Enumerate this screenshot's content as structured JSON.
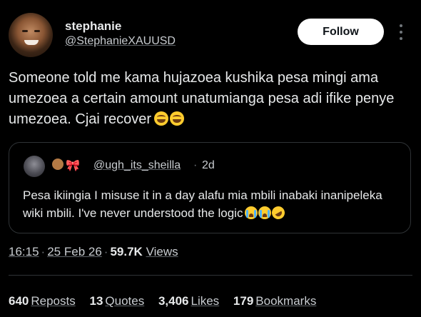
{
  "author": {
    "display_name": "stephanie",
    "handle": "@StephanieXAUUSD"
  },
  "follow_label": "Follow",
  "tweet": {
    "text": "Someone told me kama hujazoea kushika pesa mingi ama umezoea a certain amount unatumianga pesa adi ifike penye umezoea. Cjai recover",
    "emojis": [
      "grinning-squinting-face",
      "grinning-squinting-face"
    ]
  },
  "quote": {
    "handle": "@ugh_its_sheilla",
    "separator": "·",
    "time": "2d",
    "decor_emojis": [
      "teddy-bear",
      "ribbon"
    ],
    "text": "Pesa ikiingia I misuse it in a day alafu mia mbili inabaki inanipeleka wiki mbili. I've never understood the logic",
    "emojis": [
      "loudly-crying-face",
      "loudly-crying-face",
      "rolling-on-floor-laughing"
    ]
  },
  "meta": {
    "time": "16:15",
    "date": "25 Feb 26",
    "views_count": "59.7K",
    "views_label": "Views",
    "separator": "·"
  },
  "stats": {
    "reposts_count": "640",
    "reposts_label": "Reposts",
    "quotes_count": "13",
    "quotes_label": "Quotes",
    "likes_count": "3,406",
    "likes_label": "Likes",
    "bookmarks_count": "179",
    "bookmarks_label": "Bookmarks"
  },
  "colors": {
    "background": "#000000",
    "text": "#e7e9ea",
    "secondary": "#71767b",
    "border": "#2f3336",
    "follow_bg": "#ffffff"
  }
}
